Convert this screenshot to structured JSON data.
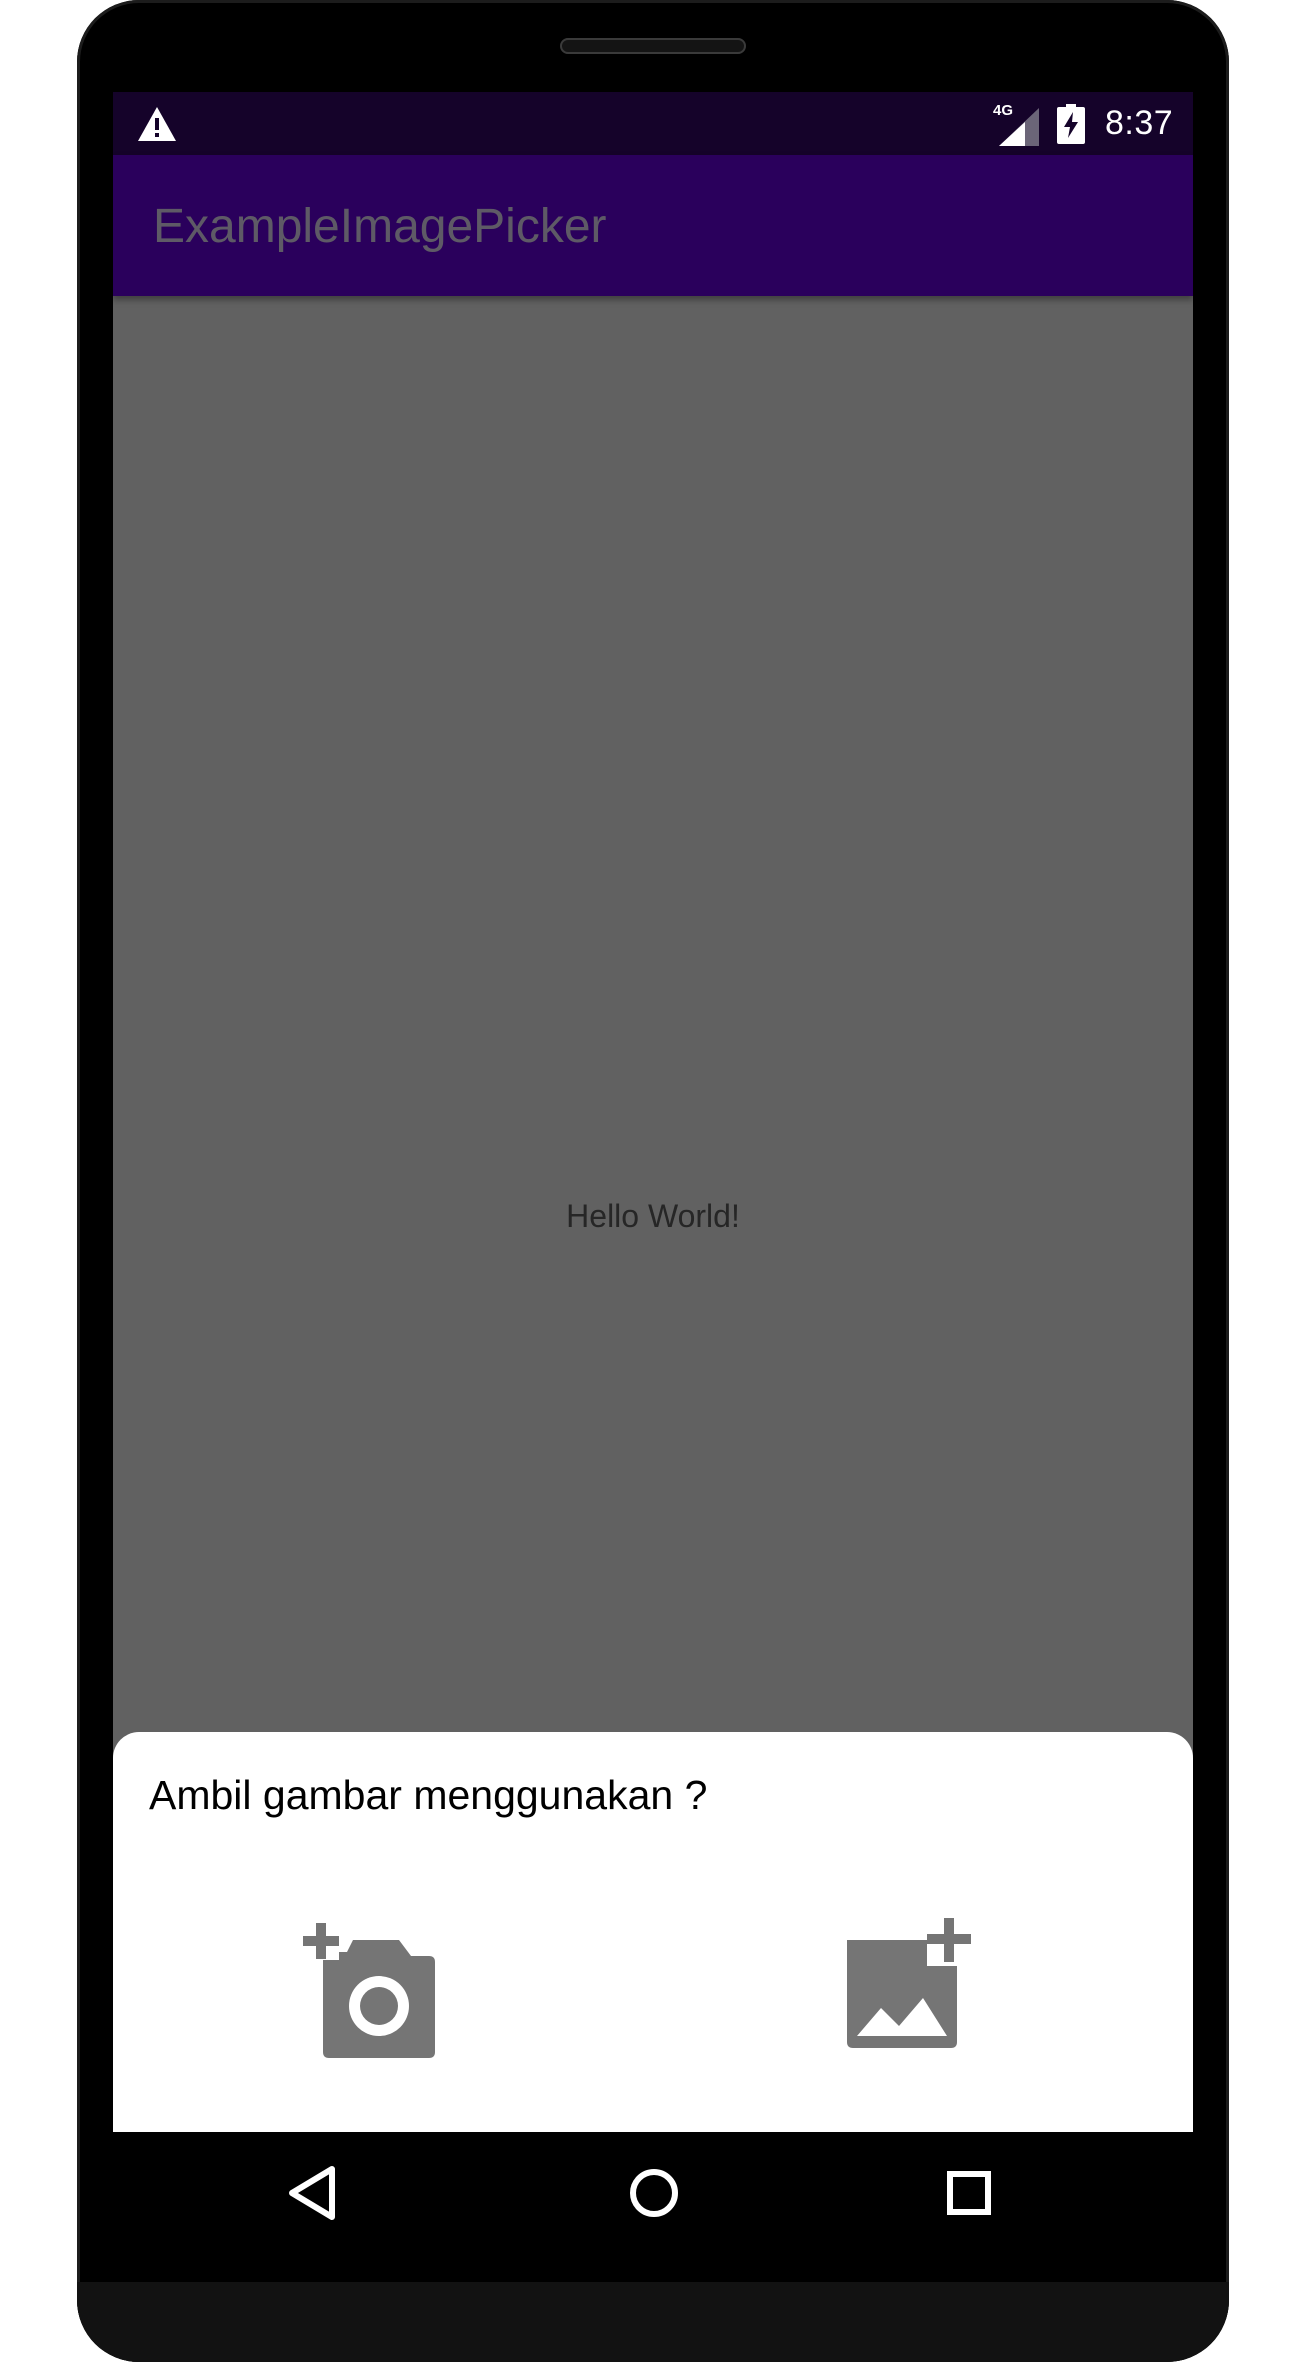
{
  "status_bar": {
    "network_type": "4G",
    "time": "8:37",
    "icons": [
      "alert-icon",
      "signal-icon",
      "battery-charging-icon"
    ]
  },
  "app_bar": {
    "title": "ExampleImagePicker"
  },
  "main": {
    "text": "Hello World!"
  },
  "picker_sheet": {
    "title": "Ambil gambar menggunakan ?",
    "options": [
      {
        "icon": "add-camera-icon"
      },
      {
        "icon": "add-photo-icon"
      }
    ]
  },
  "nav_bar": {
    "buttons": [
      "back-icon",
      "home-icon",
      "recent-apps-icon"
    ]
  },
  "colors": {
    "status_bar": "#15032a",
    "app_bar": "#2a005c",
    "scrim": "#616161",
    "icon_gray": "#757575"
  }
}
